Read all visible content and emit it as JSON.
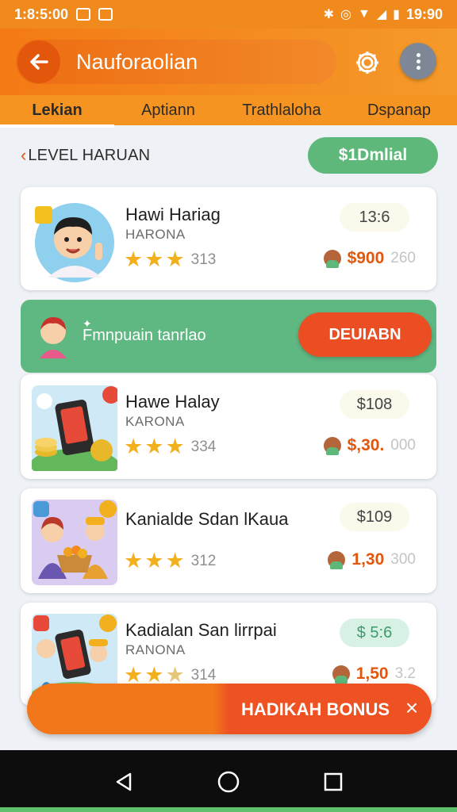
{
  "status_bar": {
    "time_left": "1:8:5:00",
    "time_right": "19:90"
  },
  "header": {
    "title": "Nauforaоlian"
  },
  "tabs": [
    {
      "label": "Lekian",
      "active": true
    },
    {
      "label": "Aptiann",
      "active": false
    },
    {
      "label": "Trathlaloha",
      "active": false
    },
    {
      "label": "Dspanap",
      "active": false
    }
  ],
  "section": {
    "title": "LEVEL HARUAN",
    "total": "$1Dmlial"
  },
  "cards": [
    {
      "name": "Hawi Hariag",
      "subtitle": "HARONA",
      "rating": "313",
      "price": "13:6",
      "reward": "$900",
      "reward_extra": "260"
    },
    {
      "name": "Hawe Halay",
      "subtitle": "KARONA",
      "rating": "334",
      "price": "$108",
      "reward": "$,30.",
      "reward_extra": "000"
    },
    {
      "name": "Kanialde Sdan lKaua",
      "subtitle": "",
      "rating": "312",
      "price": "$109",
      "reward": "1,30",
      "reward_extra": "300"
    },
    {
      "name": "Kadialan San lirrpai",
      "subtitle": "RANONA",
      "rating": "314",
      "price": "$ 5:6",
      "reward": "1,50",
      "reward_extra": "3.2"
    }
  ],
  "promo": {
    "text": "Fmnpuain tanrlao",
    "button": "DEUIABN"
  },
  "bonus": {
    "label": "HADIKAH BONUS",
    "close": "×"
  },
  "colors": {
    "primary_orange": "#f47a14",
    "accent_red": "#ea4e22",
    "green": "#5db87a",
    "star": "#f2b01e"
  }
}
